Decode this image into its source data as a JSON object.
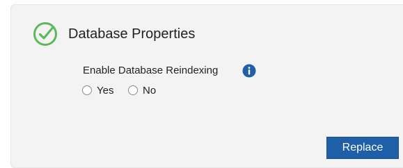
{
  "panel": {
    "title": "Database Properties",
    "status_icon": "check-circle-icon",
    "status_color": "#5cb85c"
  },
  "reindex": {
    "label": "Enable Database Reindexing",
    "info_icon": "info-icon",
    "info_color": "#1f5fa8",
    "options": [
      {
        "label": "Yes",
        "selected": false
      },
      {
        "label": "No",
        "selected": false
      }
    ]
  },
  "actions": {
    "replace_label": "Replace"
  }
}
